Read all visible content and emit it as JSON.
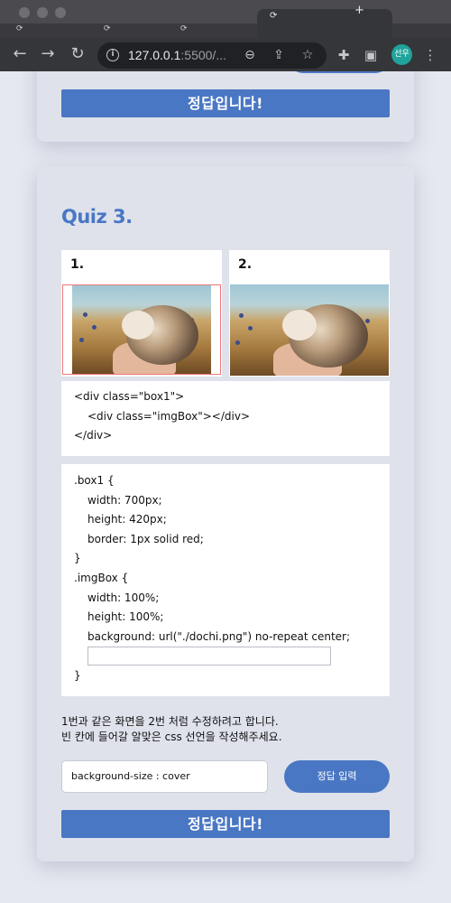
{
  "browser": {
    "url_host": "127.0.0.1",
    "url_rest": ":5500/...",
    "profile_initials": "선우"
  },
  "previous_card": {
    "correct_label": "정답입니다!"
  },
  "quiz": {
    "title": "Quiz 3.",
    "image_labels": [
      "1.",
      "2."
    ],
    "html_code": [
      "<div class=\"box1\">",
      "<div class=\"imgBox\"></div>",
      "</div>"
    ],
    "css_code": [
      ".box1 {",
      "width: 700px;",
      "height: 420px;",
      "border: 1px solid red;",
      "}",
      ".imgBox {",
      "width: 100%;",
      "height: 100%;",
      "background: url(\"./dochi.png\") no-repeat center;",
      "}"
    ],
    "description": [
      "1번과 같은 화면을 2번 처럼 수정하려고 합니다.",
      "빈 칸에 들어갈 알맞은 css 선언을 작성해주세요."
    ],
    "answer_value": "background-size : cover",
    "submit_label": "정답 입력",
    "correct_label": "정답입니다!"
  }
}
